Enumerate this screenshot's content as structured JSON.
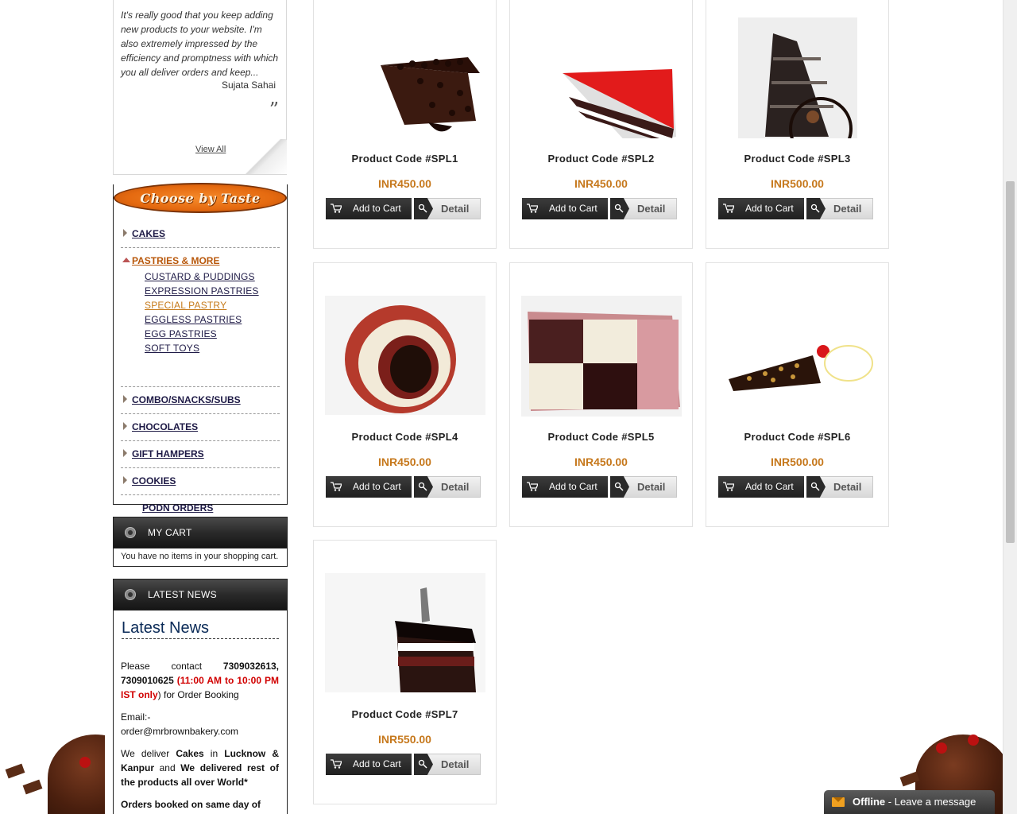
{
  "testimonial": {
    "text": "It's really good that you keep adding new products to your website. I'm also extremely impressed by the efficiency and promptness with which you all deliver orders and keep...",
    "author": "Sujata Sahai",
    "view_all": "View All"
  },
  "taste_menu": {
    "title": "Choose by Taste",
    "categories": [
      {
        "label": "CAKES"
      },
      {
        "label": "PASTRIES & MORE",
        "subs": [
          "CUSTARD & PUDDINGS",
          "EXPRESSION PASTRIES",
          "SPECIAL PASTRY",
          "EGGLESS PASTRIES",
          "EGG PASTRIES",
          "SOFT TOYS"
        ]
      },
      {
        "label": "COMBO/SNACKS/SUBS"
      },
      {
        "label": "CHOCOLATES"
      },
      {
        "label": "GIFT HAMPERS"
      },
      {
        "label": "COOKIES"
      },
      {
        "label": "PODN ORDERS"
      }
    ]
  },
  "cart": {
    "title": "MY CART",
    "empty_text": "You have no items in your shopping cart."
  },
  "news": {
    "header": "LATEST NEWS",
    "title": "Latest News",
    "p1_a": "Please contact ",
    "p1_phones": "7309032613, 7309010625",
    "p1_b": " (",
    "p1_hours": "11:00 AM to 10:00 PM IST only",
    "p1_c": ") for Order Booking",
    "email_label": "Email:-",
    "email": "order@mrbrownbakery.com",
    "p3_a": "We deliver ",
    "p3_cakes": "Cakes",
    "p3_b": " in ",
    "p3_cities": "Lucknow & Kanpur",
    "p3_c": " and ",
    "p3_d": "We delivered rest of the products all over World*",
    "p4": "Orders booked on same day of"
  },
  "products": [
    {
      "code": "Product Code #SPL1",
      "price": "INR450.00"
    },
    {
      "code": "Product Code #SPL2",
      "price": "INR450.00"
    },
    {
      "code": "Product Code #SPL3",
      "price": "INR500.00"
    },
    {
      "code": "Product Code #SPL4",
      "price": "INR450.00"
    },
    {
      "code": "Product Code #SPL5",
      "price": "INR450.00"
    },
    {
      "code": "Product Code #SPL6",
      "price": "INR500.00"
    },
    {
      "code": "Product Code #SPL7",
      "price": "INR550.00"
    }
  ],
  "buttons": {
    "add_to_cart": "Add to Cart",
    "detail": "Detail"
  },
  "chat": {
    "status": "Offline",
    "message": " - Leave a message"
  },
  "colors": {
    "price": "#c6781c",
    "menu_text": "#1e1a46",
    "active_sub": "#c67a1a",
    "accent_orange": "#e56a10"
  }
}
